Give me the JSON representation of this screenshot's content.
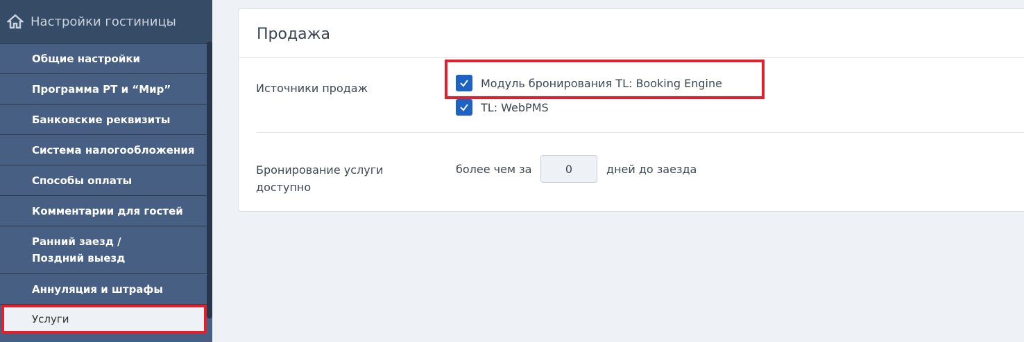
{
  "sidebar": {
    "title": "Настройки гостиницы",
    "items": [
      {
        "label": "Общие настройки"
      },
      {
        "label": "Программа РТ и “Мир”"
      },
      {
        "label": "Банковские реквизиты"
      },
      {
        "label": "Система налогообложения"
      },
      {
        "label": "Способы оплаты"
      },
      {
        "label": "Комментарии для гостей"
      },
      {
        "label": "Ранний заезд / Поздний выезд"
      },
      {
        "label": "Аннуляция и штрафы"
      },
      {
        "label": "Услуги"
      }
    ]
  },
  "main": {
    "title": "Продажа",
    "sources_label": "Источники продаж",
    "sources": [
      {
        "label": "Модуль бронирования TL: Booking Engine",
        "checked": true
      },
      {
        "label": "TL: WebPMS",
        "checked": true
      }
    ],
    "booking_label": "Бронирование услуги доступно",
    "before_text": "более чем за",
    "days_value": "0",
    "after_text": "дней до заезда"
  }
}
